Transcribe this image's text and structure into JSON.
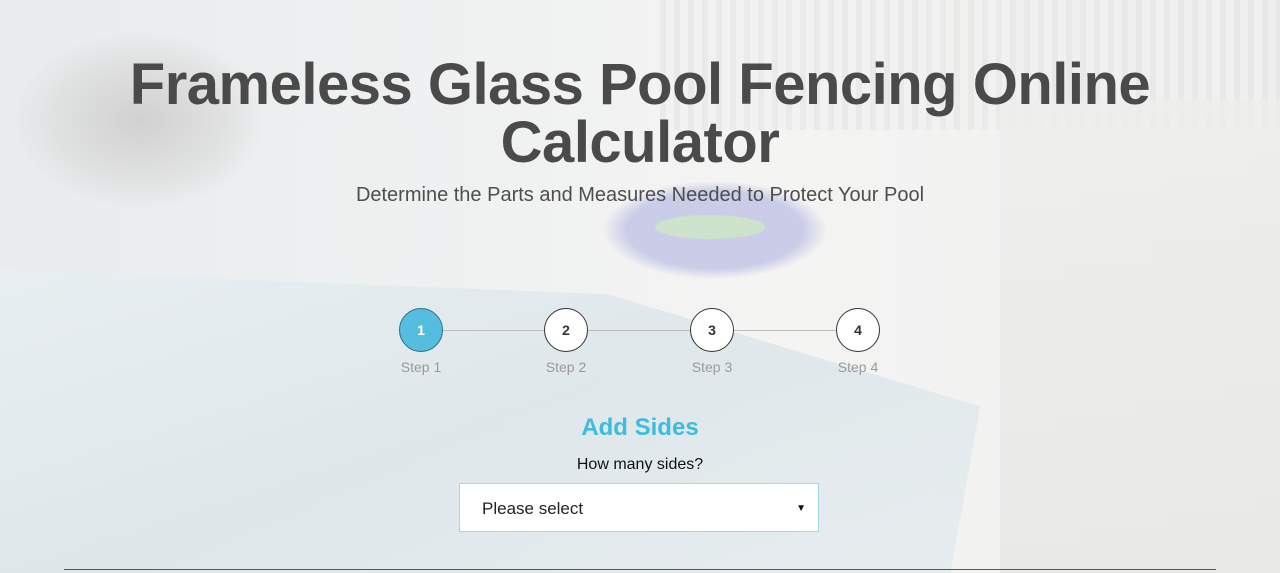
{
  "header": {
    "title_line1": "Frameless Glass Pool Fencing Online",
    "title_line2": "Calculator",
    "subtitle": "Determine the Parts and Measures Needed to Protect Your Pool"
  },
  "stepper": {
    "current_step": 1,
    "steps": [
      {
        "number": "1",
        "label": "Step 1"
      },
      {
        "number": "2",
        "label": "Step 2"
      },
      {
        "number": "3",
        "label": "Step 3"
      },
      {
        "number": "4",
        "label": "Step 4"
      }
    ]
  },
  "form": {
    "section_title": "Add Sides",
    "sides_label": "How many sides?",
    "sides_select_value": "Please select",
    "caret_icon": "caret-down-icon"
  },
  "colors": {
    "accent": "#3cbcdf",
    "active_step": "#55bde0",
    "title": "#4a4a4a",
    "divider": "#1f6b86"
  }
}
